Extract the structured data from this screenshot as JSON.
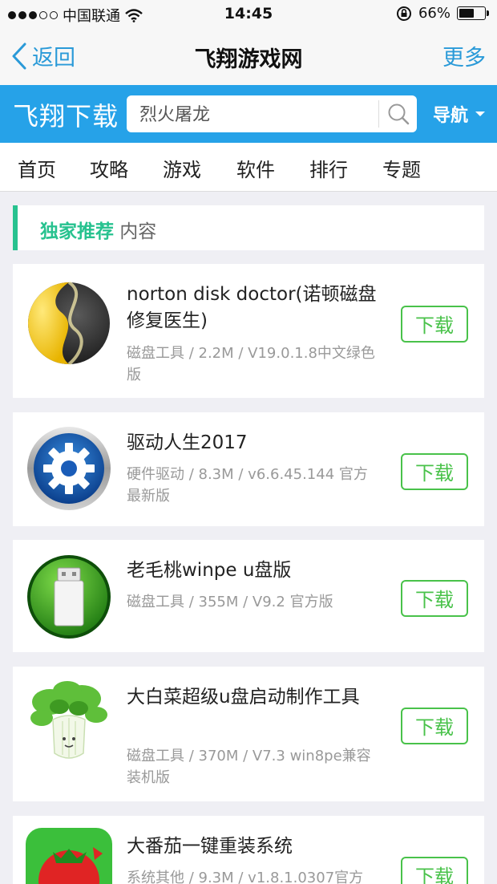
{
  "status_bar": {
    "carrier": "中国联通",
    "time": "14:45",
    "battery_percent": "66%",
    "battery_level": 0.66
  },
  "nav": {
    "back_label": "返回",
    "title": "飞翔游戏网",
    "more_label": "更多"
  },
  "header": {
    "brand": "飞翔下载",
    "search_value": "烈火屠龙",
    "menu_label": "导航",
    "accent_color": "#26a2e8"
  },
  "tabs": [
    "首页",
    "攻略",
    "游戏",
    "软件",
    "排行",
    "专题"
  ],
  "section": {
    "highlight": "独家推荐",
    "rest": " 内容"
  },
  "apps": [
    {
      "name": "norton disk doctor(诺顿磁盘修复医生)",
      "meta": "磁盘工具 / 2.2M / V19.0.1.8中文绿色版",
      "icon": "norton-icon",
      "button": "下载"
    },
    {
      "name": "驱动人生2017",
      "meta": "硬件驱动 / 8.3M / v6.6.45.144 官方最新版",
      "icon": "gear-icon",
      "button": "下载"
    },
    {
      "name": "老毛桃winpe u盘版",
      "meta": "磁盘工具 / 355M / V9.2 官方版",
      "icon": "usb-drive-icon",
      "button": "下载"
    },
    {
      "name": "大白菜超级u盘启动制作工具",
      "meta": "磁盘工具 / 370M / V7.3 win8pe兼容装机版",
      "icon": "cabbage-icon",
      "button": "下载"
    },
    {
      "name": "大番茄一键重装系统",
      "meta": "系统其他 / 9.3M / v1.8.1.0307官方",
      "icon": "tomato-icon",
      "button": "下载"
    }
  ]
}
